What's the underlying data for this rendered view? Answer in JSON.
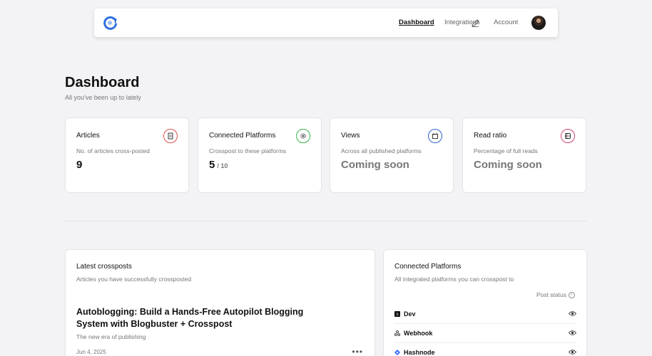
{
  "nav": {
    "links": [
      {
        "label": "Dashboard",
        "active": true
      },
      {
        "label": "Integrations",
        "active": false
      },
      {
        "label": "Account",
        "active": false
      }
    ]
  },
  "header": {
    "title": "Dashboard",
    "subtitle": "All you've been up to lately"
  },
  "stats": [
    {
      "title": "Articles",
      "description": "No. of articles cross-posted",
      "value": "9",
      "suffix": "",
      "icon": "article-icon",
      "icon_color": "#d9534f"
    },
    {
      "title": "Connected Platforms",
      "description": "Crosspost to these platforms",
      "value": "5",
      "suffix": "/ 10",
      "icon": "settings-icon",
      "icon_color": "#3cb44b"
    },
    {
      "title": "Views",
      "description": "Across all published platforms",
      "value": "Coming soon",
      "suffix": "",
      "icon": "calendar-icon",
      "icon_color": "#2f5fd0"
    },
    {
      "title": "Read ratio",
      "description": "Percentage of full reads",
      "value": "Coming soon",
      "suffix": "",
      "icon": "book-icon",
      "icon_color": "#d4436b"
    }
  ],
  "latest": {
    "title": "Latest crossposts",
    "subtitle": "Articles you have successfully crossposted",
    "post": {
      "title": "Autoblogging: Build a Hands-Free Autopilot Blogging System with Blogbuster + Crosspost",
      "subtitle": "The new era of publishing",
      "date": "Jun 4, 2025"
    }
  },
  "platforms": {
    "title": "Connected Platforms",
    "subtitle": "All integrated platforms you can crosspost to",
    "status_label": "Post status",
    "items": [
      {
        "name": "Dev",
        "icon": "dev-icon"
      },
      {
        "name": "Webhook",
        "icon": "webhook-icon"
      },
      {
        "name": "Hashnode",
        "icon": "hashnode-icon"
      }
    ]
  },
  "colors": {
    "background": "#f3f3f5",
    "card": "#ffffff",
    "logo_blue": "#2f6fe0",
    "hashnode_blue": "#2962ff"
  }
}
